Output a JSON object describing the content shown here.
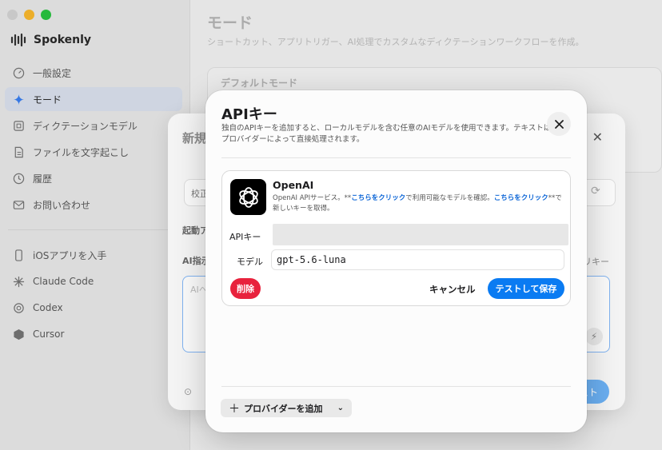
{
  "sidebar": {
    "brand": "Spokenly",
    "items": [
      {
        "label": "一般設定",
        "icon": "dashboard-icon"
      },
      {
        "label": "モード",
        "icon": "sparkle-icon",
        "active": true
      },
      {
        "label": "ディクテーションモデル",
        "icon": "chip-icon"
      },
      {
        "label": "ファイルを文字起こし",
        "icon": "document-icon"
      },
      {
        "label": "履歴",
        "icon": "clock-icon"
      },
      {
        "label": "お問い合わせ",
        "icon": "mail-icon"
      }
    ],
    "extras": [
      {
        "label": "iOSアプリを入手",
        "icon": "phone-icon"
      },
      {
        "label": "Claude Code",
        "icon": "claude-icon"
      },
      {
        "label": "Codex",
        "icon": "openai-icon"
      },
      {
        "label": "Cursor",
        "icon": "cursor-icon"
      }
    ]
  },
  "main": {
    "title": "モード",
    "subtitle": "ショートカット、アプリトリガー、AI処理でカスタムなディクテーションワークフローを作成。",
    "card_title": "デフォルトモード"
  },
  "back_dialog": {
    "title": "新規",
    "input_text": "校正",
    "label_start": "起動ア",
    "label_ai": "AI指示",
    "label_right": "リキー",
    "textarea_placeholder": "AIへ",
    "save_partial": "スト"
  },
  "dialog": {
    "title": "APIキー",
    "description": "独自のAPIキーを追加すると、ローカルモデルを含む任意のAIモデルを使用できます。テキストはプロバイダーによって直接処理されます。",
    "provider": {
      "name": "OpenAI",
      "desc_prefix": "OpenAI APIサービス。**",
      "link1": "こちらをクリック",
      "desc_mid": "で利用可能なモデルを確認。",
      "link2": "こちらをクリック",
      "desc_suffix": "**で新しいキーを取得。",
      "api_key_label": "APIキー",
      "api_key_value": "",
      "model_label": "モデル",
      "model_value": "gpt-5.6-luna",
      "delete_label": "削除",
      "cancel_label": "キャンセル",
      "save_label": "テストして保存"
    },
    "add_provider_label": "プロバイダーを追加"
  }
}
